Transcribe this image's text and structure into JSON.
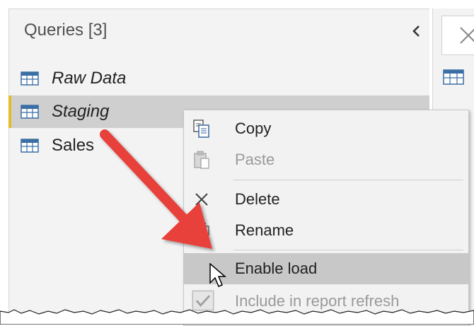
{
  "queries": {
    "title": "Queries [3]",
    "items": [
      {
        "label": "Raw Data",
        "icon": "table-icon"
      },
      {
        "label": "Staging",
        "icon": "table-icon"
      },
      {
        "label": "Sales",
        "icon": "table-icon"
      }
    ]
  },
  "context_menu": {
    "items": [
      {
        "label": "Copy",
        "icon": "copy-icon"
      },
      {
        "label": "Paste",
        "icon": "paste-icon"
      },
      {
        "label": "Delete",
        "icon": "close-icon"
      },
      {
        "label": "Rename",
        "icon": "rename-icon"
      },
      {
        "label": "Enable load",
        "icon": ""
      },
      {
        "label": "Include in report refresh",
        "icon": "checkmark-icon"
      }
    ]
  },
  "colors": {
    "selection_accent": "#e8b928",
    "arrow": "#e8403a",
    "menu_hover": "#c8c8c8"
  }
}
